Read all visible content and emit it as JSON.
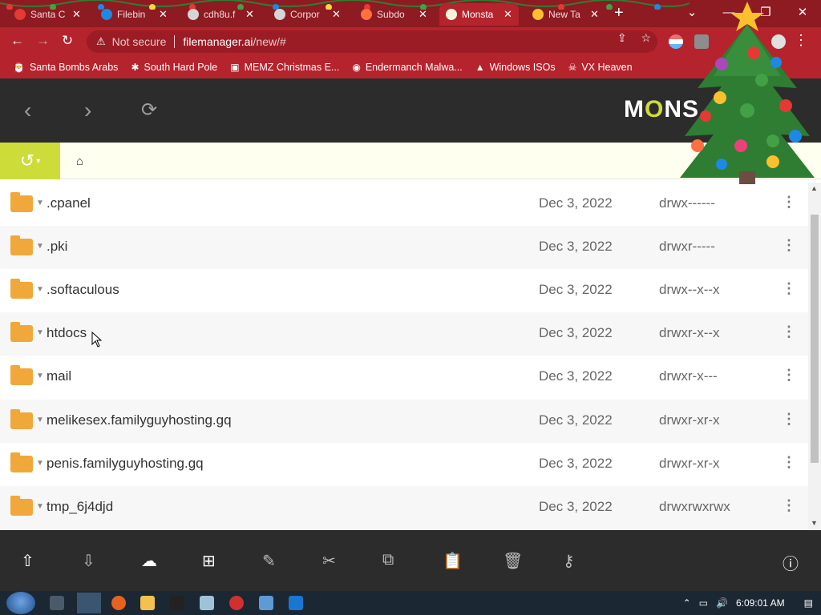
{
  "browser": {
    "tabs": [
      {
        "title": "Santa C",
        "favicon": "tree-ornament-icon",
        "active": false
      },
      {
        "title": "Filebin",
        "favicon": "file-icon",
        "active": false
      },
      {
        "title": "cdh8u.f",
        "favicon": "globe-icon",
        "active": false
      },
      {
        "title": "Corpor",
        "favicon": "globe-icon",
        "active": false
      },
      {
        "title": "Subdo",
        "favicon": "paw-icon",
        "active": false
      },
      {
        "title": "Monsta",
        "favicon": "monsta-icon",
        "active": true
      },
      {
        "title": "New Ta",
        "favicon": "chrome-icon",
        "active": false
      }
    ],
    "new_tab": "+",
    "security_label": "Not secure",
    "url_host": "filemanager.ai",
    "url_path": "/new/#",
    "bookmarks": [
      {
        "label": "Santa Bombs Arabs",
        "icon": "santa-icon"
      },
      {
        "label": "South Hard Pole",
        "icon": "snowflake-icon"
      },
      {
        "label": "MEMZ Christmas E...",
        "icon": "image-icon"
      },
      {
        "label": "Endermanch Malwa...",
        "icon": "raccoon-icon"
      },
      {
        "label": "Windows ISOs",
        "icon": "tree-icon"
      },
      {
        "label": "VX Heaven",
        "icon": "skull-icon"
      }
    ]
  },
  "app": {
    "logo_text_1": "M",
    "logo_text_2": "O",
    "logo_text_3": "NS",
    "accent": "#cddc39",
    "files": [
      {
        "name": ".cpanel",
        "date": "Dec 3, 2022",
        "perms": "drwx------"
      },
      {
        "name": ".pki",
        "date": "Dec 3, 2022",
        "perms": "drwxr-----"
      },
      {
        "name": ".softaculous",
        "date": "Dec 3, 2022",
        "perms": "drwx--x--x"
      },
      {
        "name": "htdocs",
        "date": "Dec 3, 2022",
        "perms": "drwxr-x--x"
      },
      {
        "name": "mail",
        "date": "Dec 3, 2022",
        "perms": "drwxr-x---"
      },
      {
        "name": "melikesex.familyguyhosting.gq",
        "date": "Dec 3, 2022",
        "perms": "drwxr-xr-x"
      },
      {
        "name": "penis.familyguyhosting.gq",
        "date": "Dec 3, 2022",
        "perms": "drwxr-xr-x"
      },
      {
        "name": "tmp_6j4djd",
        "date": "Dec 3, 2022",
        "perms": "drwxrwxrwx"
      }
    ]
  },
  "taskbar": {
    "clock": "6:09:01 AM"
  }
}
